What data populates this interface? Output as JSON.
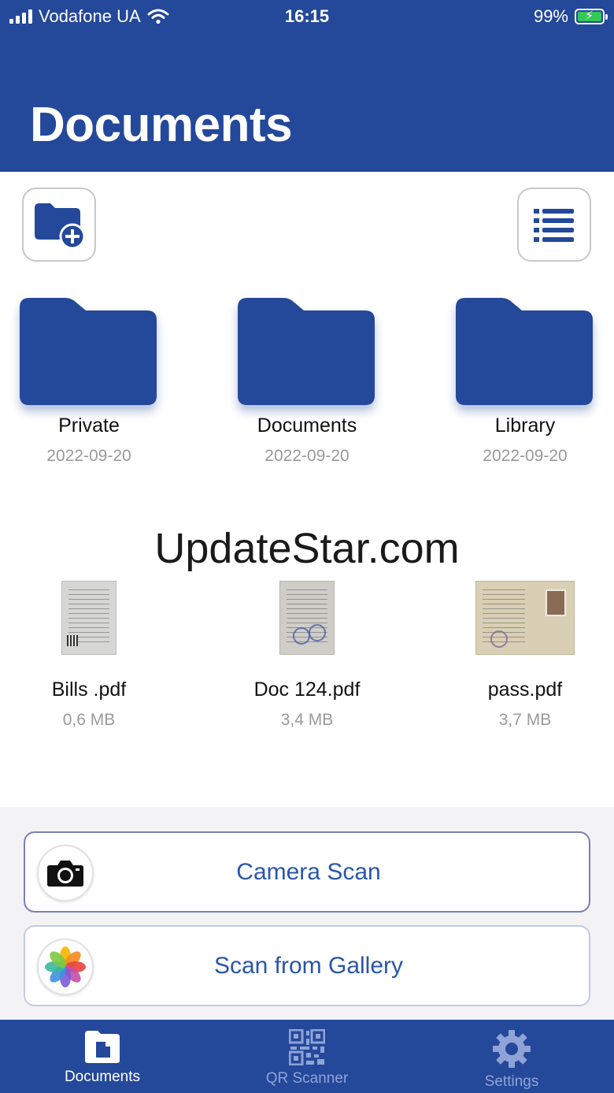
{
  "status_bar": {
    "carrier": "Vodafone UA",
    "time": "16:15",
    "battery": "99%"
  },
  "header": {
    "title": "Documents"
  },
  "toolbar": {
    "new_folder_icon": "folder-plus-icon",
    "list_view_icon": "list-icon"
  },
  "folders": [
    {
      "name": "Private",
      "date": "2022-09-20"
    },
    {
      "name": "Documents",
      "date": "2022-09-20"
    },
    {
      "name": "Library",
      "date": "2022-09-20"
    }
  ],
  "watermark": "UpdateStar.com",
  "files": [
    {
      "name": "Bills .pdf",
      "size": "0,6 MB"
    },
    {
      "name": "Doc 124.pdf",
      "size": "3,4 MB"
    },
    {
      "name": "pass.pdf",
      "size": "3,7 MB"
    }
  ],
  "actions": {
    "camera_scan": "Camera Scan",
    "scan_gallery": "Scan from Gallery"
  },
  "tabbar": {
    "documents": "Documents",
    "qr_scanner": "QR Scanner",
    "settings": "Settings"
  },
  "colors": {
    "brand": "#24489a",
    "accent_text": "#2a56a8",
    "battery": "#34c759"
  }
}
